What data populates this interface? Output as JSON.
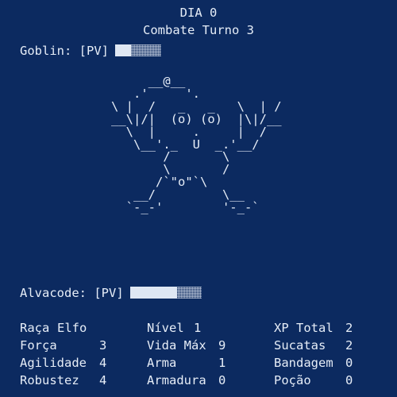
{
  "header": {
    "day": "DIA 0",
    "turn": "Combate Turno 3"
  },
  "enemy": {
    "name_label": "Goblin:",
    "hp_label": "[PV]",
    "hp_fraction": 0.35
  },
  "art": "     __@__\n   .'     '.\n\\ |  /   _   _   \\  | /\n__\\|/|  (o) (o)  |\\|/__\n  \\  |     .     |  /\n   \\__'._  U  _.'__/\n       /       \\\n       \\       /\n      /`\"o\"`\\\n   __/         \\__\n  `-_-'        '-_-`",
  "player": {
    "name_label": "Alvacode:",
    "hp_label": "[PV]",
    "hp_fraction": 0.66
  },
  "stats": [
    [
      {
        "label": "Raça",
        "value": "Elfo"
      },
      {
        "label": "Nível",
        "value": "1"
      },
      {
        "label": "XP Total",
        "value": "2"
      }
    ],
    [
      {
        "label": "Força",
        "value": "3"
      },
      {
        "label": "Vida Máx",
        "value": "9"
      },
      {
        "label": "Sucatas",
        "value": "2"
      }
    ],
    [
      {
        "label": "Agilidade",
        "value": "4"
      },
      {
        "label": "Arma",
        "value": "1"
      },
      {
        "label": "Bandagem",
        "value": "0"
      }
    ],
    [
      {
        "label": "Robustez",
        "value": "4"
      },
      {
        "label": "Armadura",
        "value": "0"
      },
      {
        "label": "Poção",
        "value": "0"
      }
    ]
  ]
}
